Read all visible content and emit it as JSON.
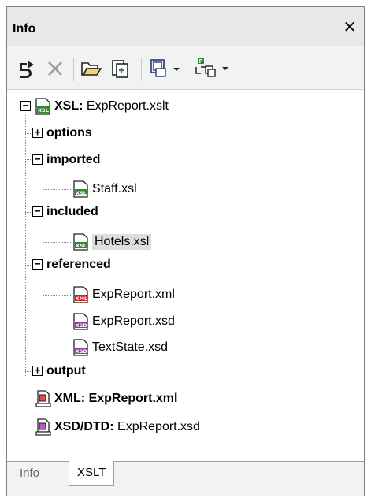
{
  "panel": {
    "title": "Info",
    "close_glyph": "✕"
  },
  "toolbar": {
    "buttons": [
      {
        "name": "reset-icon"
      },
      {
        "name": "delete-icon"
      },
      {
        "name": "open-folder-icon"
      },
      {
        "name": "add-file-icon"
      },
      {
        "name": "properties-icon"
      },
      {
        "name": "tree-options-icon"
      }
    ]
  },
  "tree": {
    "root": {
      "prefix": "XSL:",
      "name": "ExpReport.xslt",
      "icon": "xsl-icon"
    },
    "options": "options",
    "imported": "imported",
    "imported_files": [
      {
        "name": "Staff.xsl",
        "icon": "xsl-icon"
      }
    ],
    "included": "included",
    "included_files": [
      {
        "name": "Hotels.xsl",
        "icon": "xsl-icon"
      }
    ],
    "referenced": "referenced",
    "referenced_files": [
      {
        "name": "ExpReport.xml",
        "icon": "xml-icon"
      },
      {
        "name": "ExpReport.xsd",
        "icon": "xsd-icon"
      },
      {
        "name": "TextState.xsd",
        "icon": "xsd-icon"
      }
    ],
    "output": "output",
    "xml": {
      "prefix": "XML:",
      "name": "ExpReport.xml"
    },
    "xsd": {
      "prefix": "XSD/DTD:",
      "name": "ExpReport.xsd"
    }
  },
  "tabs": [
    {
      "label": "Info",
      "active": false
    },
    {
      "label": "XSLT",
      "active": true
    }
  ],
  "colors": {
    "xsl": "#2e8b2e",
    "xml": "#d32020",
    "xsd": "#8b3fa0"
  }
}
